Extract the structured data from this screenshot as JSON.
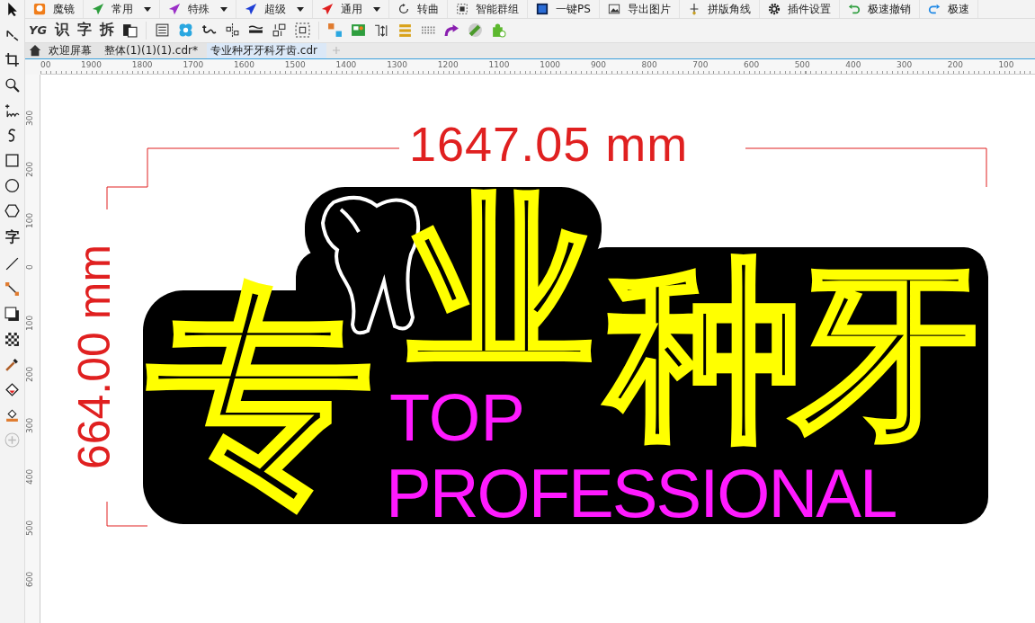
{
  "toolbar": [
    {
      "label": "魔镜",
      "has_menu": false
    },
    {
      "label": "常用",
      "has_menu": true
    },
    {
      "label": "特殊",
      "has_menu": true
    },
    {
      "label": "超级",
      "has_menu": true
    },
    {
      "label": "通用",
      "has_menu": true
    },
    {
      "label": "转曲",
      "has_menu": false
    },
    {
      "label": "智能群组",
      "has_menu": false
    },
    {
      "label": "一键PS",
      "has_menu": false
    },
    {
      "label": "导出图片",
      "has_menu": false
    },
    {
      "label": "拼版角线",
      "has_menu": false
    },
    {
      "label": "插件设置",
      "has_menu": false
    },
    {
      "label": "极速撤销",
      "has_menu": false
    },
    {
      "label": "极速",
      "has_menu": false
    }
  ],
  "text_tools": [
    "YG",
    "识",
    "字",
    "拆"
  ],
  "tabs": [
    {
      "label": "欢迎屏幕",
      "selected": false
    },
    {
      "label": "整体(1)(1)(1).cdr*",
      "selected": false
    },
    {
      "label": "专业种牙牙科牙齿.cdr",
      "selected": true
    }
  ],
  "toolbox_text_tool": "字",
  "ruler_h": [
    "00",
    "1900",
    "1800",
    "1700",
    "1600",
    "1500",
    "1400",
    "1300",
    "1200",
    "1100",
    "1000",
    "900",
    "800",
    "700",
    "600",
    "500",
    "400",
    "300",
    "200",
    "100"
  ],
  "ruler_v": [
    "300",
    "200",
    "100",
    "0",
    "100",
    "200",
    "300",
    "400",
    "500",
    "600"
  ],
  "dimensions": {
    "width": "1647.05 mm",
    "height": "664.00 mm"
  },
  "sign": {
    "characters": [
      "专",
      "业",
      "种",
      "牙"
    ],
    "line1": "TOP",
    "line2": "PROFESSIONAL"
  }
}
